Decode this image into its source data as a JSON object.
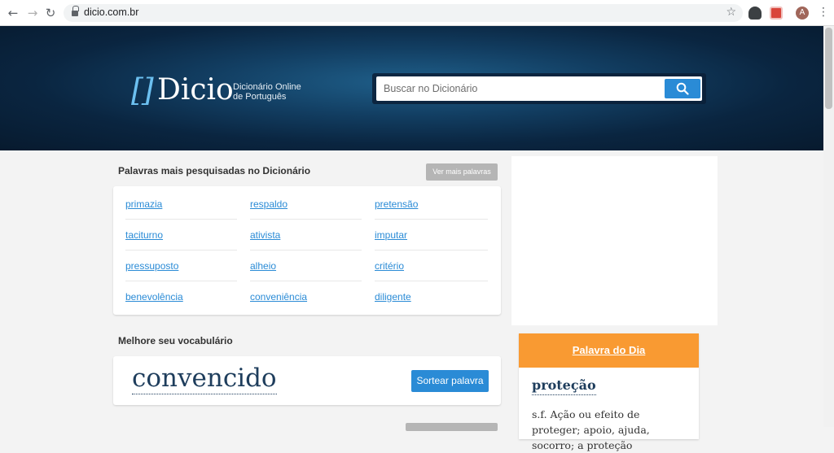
{
  "browser": {
    "url": "dicio.com.br",
    "back_icon": "arrow-left-icon",
    "forward_icon": "arrow-right-icon",
    "reload_icon": "reload-icon",
    "avatar_letter": "A"
  },
  "header": {
    "logo_bracket": "[]",
    "logo": "Dicio",
    "subtitle_line1": "Dicionário Online",
    "subtitle_line2": "de Português",
    "search_placeholder": "Buscar no Dicionário"
  },
  "popular": {
    "title": "Palavras mais pesquisadas no Dicionário",
    "more_label": "Ver mais palavras",
    "words": [
      [
        "primazia",
        "respaldo",
        "pretensão"
      ],
      [
        "taciturno",
        "ativista",
        "imputar"
      ],
      [
        "pressuposto",
        "alheio",
        "critério"
      ],
      [
        "benevolência",
        "conveniência",
        "diligente"
      ]
    ]
  },
  "vocab": {
    "title": "Melhore seu vocabulário",
    "word": "convencido",
    "button_label": "Sortear palavra"
  },
  "palavra_do_dia": {
    "title": "Palavra do Dia",
    "word": "proteção",
    "definition": "s.f. Ação ou efeito de proteger; apoio, ajuda, socorro; a proteção"
  },
  "colors": {
    "accent": "#2a8bd6",
    "orange": "#f99a32",
    "header_dark": "#0a2540"
  }
}
